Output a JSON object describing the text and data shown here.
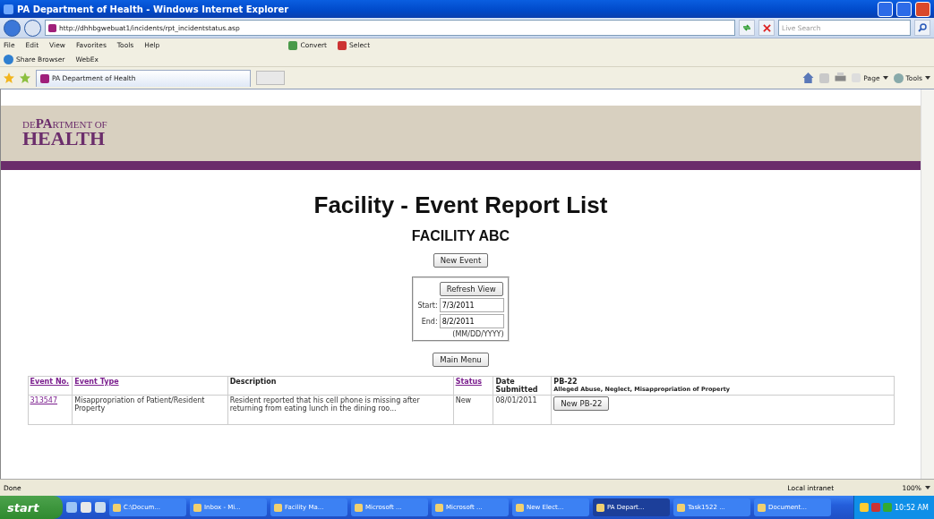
{
  "window": {
    "title": "PA Department of Health - Windows Internet Explorer"
  },
  "address_bar": {
    "url": "http://dhhbgwebuat1/incidents/rpt_incidentstatus.asp",
    "search_placeholder": "Live Search"
  },
  "menu": [
    "File",
    "Edit",
    "View",
    "Favorites",
    "Tools",
    "Help"
  ],
  "menu_tools": [
    "Convert",
    "Select"
  ],
  "links_bar": [
    "Share Browser",
    "WebEx"
  ],
  "tabs": [
    {
      "label": "PA Department of Health",
      "selected": true
    }
  ],
  "command_bar": [
    "Page",
    "Tools"
  ],
  "page": {
    "logo": "DE**PA**RTMENT OF",
    "logo_big": "HEALTH",
    "title": "Facility - Event Report List",
    "facility": "FACILITY ABC",
    "new_event": "New Event",
    "refresh": "Refresh View",
    "start_label": "Start:",
    "start_value": "7/3/2011",
    "end_label": "End:",
    "end_value": "8/2/2011",
    "date_hint": "(MM/DD/YYYY)",
    "main_menu": "Main Menu"
  },
  "table": {
    "columns": [
      {
        "label": "Event No.",
        "link": true
      },
      {
        "label": "Event Type",
        "link": true
      },
      {
        "label": "Description",
        "link": false
      },
      {
        "label": "Status",
        "link": true
      },
      {
        "label": "Date Submitted",
        "link": false
      },
      {
        "label": "PB-22",
        "link": false,
        "subtitle": "Alleged Abuse, Neglect, Misappropriation of Property"
      }
    ],
    "rows": [
      {
        "event_no": "313547",
        "event_type": "Misappropriation of Patient/Resident Property",
        "description": "Resident reported that his cell phone is missing after returning from eating lunch in the dining roo...",
        "status": "New",
        "date": "08/01/2011",
        "action": "New PB-22"
      }
    ]
  },
  "status_bar": {
    "text": "Done",
    "zone": "Local intranet",
    "zoom": "100%"
  },
  "taskbar": {
    "start": "start",
    "tasks": [
      {
        "label": "C:\\Docum...",
        "selected": false
      },
      {
        "label": "Inbox - Mi...",
        "selected": false
      },
      {
        "label": "Facility Ma...",
        "selected": false
      },
      {
        "label": "Microsoft ...",
        "selected": false
      },
      {
        "label": "Microsoft ...",
        "selected": false
      },
      {
        "label": "New Elect...",
        "selected": false
      },
      {
        "label": "PA Depart...",
        "selected": true
      },
      {
        "label": "Task1522 ...",
        "selected": false
      },
      {
        "label": "Document...",
        "selected": false
      }
    ],
    "clock": "10:52 AM"
  }
}
